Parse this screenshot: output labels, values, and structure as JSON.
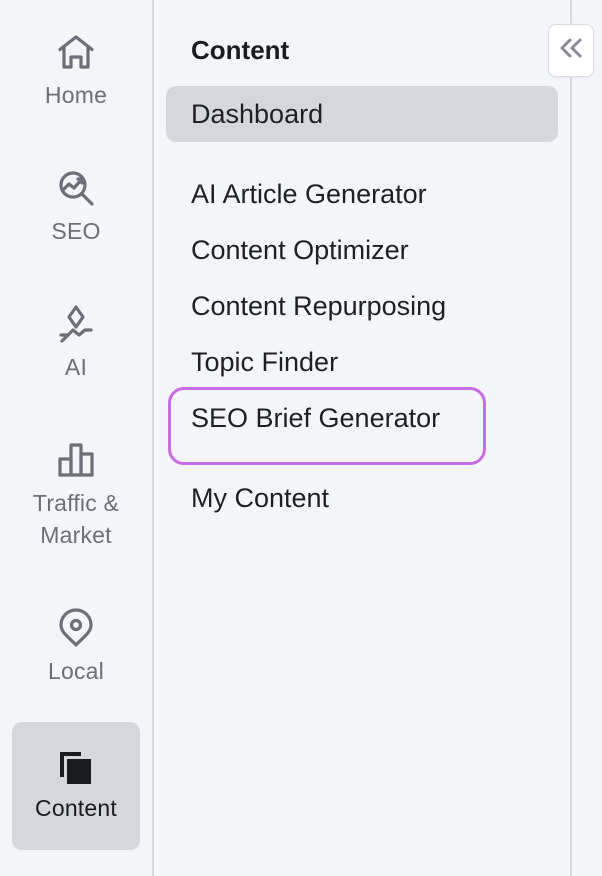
{
  "rail": {
    "items": [
      {
        "label": "Home",
        "icon": "home-icon"
      },
      {
        "label": "SEO",
        "icon": "seo-chart-icon"
      },
      {
        "label": "AI",
        "icon": "ai-sparkle-icon"
      },
      {
        "label": "Traffic &\nMarket",
        "label_line1": "Traffic &",
        "label_line2": "Market",
        "icon": "bar-chart-icon"
      },
      {
        "label": "Local",
        "icon": "location-pin-icon"
      },
      {
        "label": "Content",
        "icon": "content-pages-icon",
        "active": true
      }
    ]
  },
  "panel": {
    "title": "Content",
    "menu": [
      {
        "label": "Dashboard",
        "active": true
      },
      {
        "label": "AI Article Generator"
      },
      {
        "label": "Content Optimizer"
      },
      {
        "label": "Content Repurposing"
      },
      {
        "label": "Topic Finder"
      },
      {
        "label": "SEO Brief Generator",
        "highlighted": true
      },
      {
        "label": "My Content"
      }
    ]
  },
  "collapse_button": {
    "icon": "double-chevron-left-icon"
  },
  "colors": {
    "background": "#f4f5f9",
    "active_bg": "#d6d7dc",
    "highlight": "#c76ce6",
    "icon_muted": "#6c6e78",
    "text": "#1f2024"
  }
}
